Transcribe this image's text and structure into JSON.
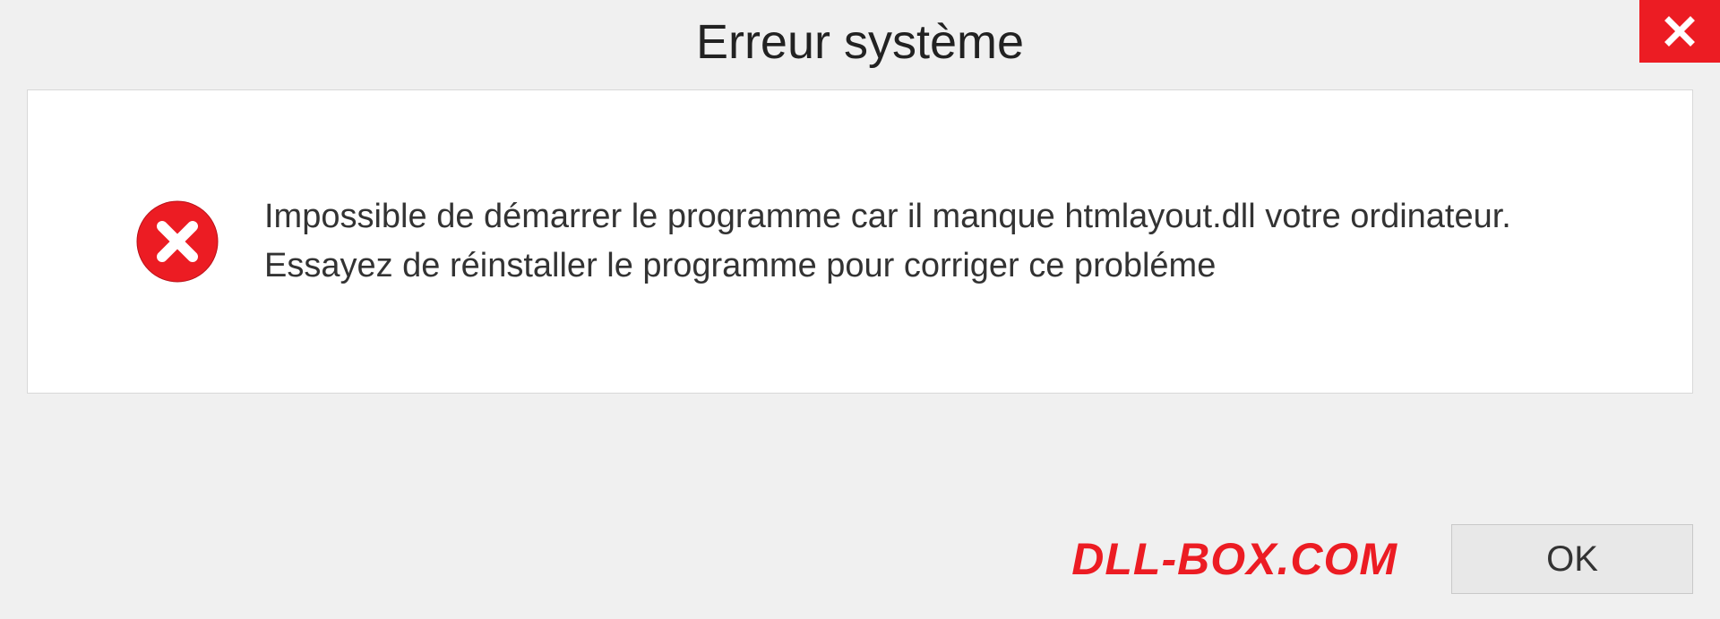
{
  "dialog": {
    "title": "Erreur système",
    "message": "Impossible de démarrer le programme car il manque htmlayout.dll votre ordinateur. Essayez de réinstaller le programme pour corriger ce probléme",
    "ok_label": "OK"
  },
  "watermark": "DLL-BOX.COM",
  "colors": {
    "error_red": "#ec1c23",
    "background": "#f0f0f0",
    "panel": "#ffffff"
  }
}
